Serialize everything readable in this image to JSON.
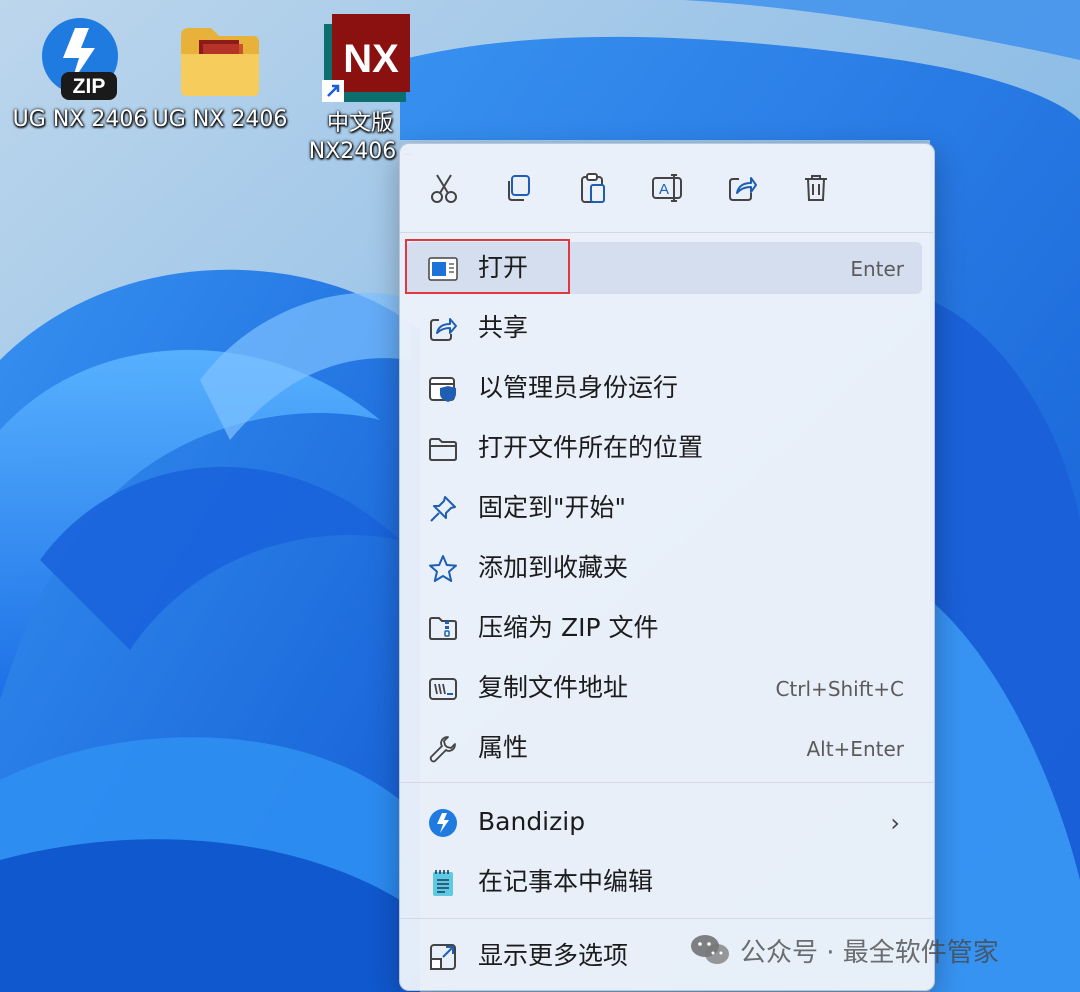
{
  "desktop": {
    "icons": [
      {
        "label": "UG NX 2406",
        "badge": "ZIP"
      },
      {
        "label": "UG NX 2406"
      },
      {
        "label1": "中文版",
        "label2": "NX2406 -",
        "badge": "NX"
      }
    ]
  },
  "context_menu": {
    "toolbar": [
      "cut-icon",
      "copy-icon",
      "paste-icon",
      "rename-icon",
      "share-icon",
      "delete-icon"
    ],
    "items": [
      {
        "label": "打开",
        "shortcut": "Enter",
        "icon": "open-icon"
      },
      {
        "label": "共享",
        "icon": "share-icon"
      },
      {
        "label": "以管理员身份运行",
        "icon": "run-as-admin-icon"
      },
      {
        "label": "打开文件所在的位置",
        "icon": "folder-icon"
      },
      {
        "label": "固定到\"开始\"",
        "icon": "pin-icon"
      },
      {
        "label": "添加到收藏夹",
        "icon": "star-icon"
      },
      {
        "label": "压缩为 ZIP 文件",
        "icon": "zip-icon"
      },
      {
        "label": "复制文件地址",
        "shortcut": "Ctrl+Shift+C",
        "icon": "copy-path-icon"
      },
      {
        "label": "属性",
        "shortcut": "Alt+Enter",
        "icon": "wrench-icon"
      }
    ],
    "items2": [
      {
        "label": "Bandizip",
        "icon": "bandizip-icon",
        "submenu_glyph": "›"
      },
      {
        "label": "在记事本中编辑",
        "icon": "notepad-icon"
      }
    ],
    "more": {
      "label": "显示更多选项",
      "icon": "show-more-icon"
    }
  },
  "watermark": {
    "text": "公众号 · 最全软件管家"
  },
  "colors": {
    "accent": "#0067c0",
    "highlight_box": "#e2373f"
  }
}
